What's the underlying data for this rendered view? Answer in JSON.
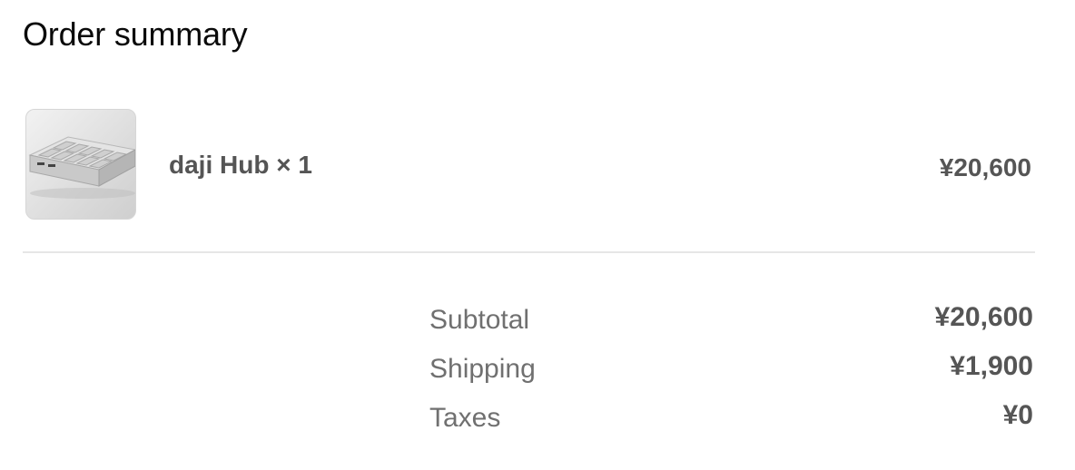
{
  "page": {
    "title": "Order summary"
  },
  "line_item": {
    "image_icon": "product-image-hub",
    "name": "daji Hub × 1",
    "price": "¥20,600"
  },
  "summary": {
    "rows": [
      {
        "label": "Subtotal",
        "value": "¥20,600"
      },
      {
        "label": "Shipping",
        "value": "¥1,900"
      },
      {
        "label": "Taxes",
        "value": "¥0"
      }
    ]
  },
  "colors": {
    "text_primary": "#0a0a0a",
    "text_secondary": "#555555",
    "text_label": "#707070",
    "divider": "#e6e6e6"
  }
}
